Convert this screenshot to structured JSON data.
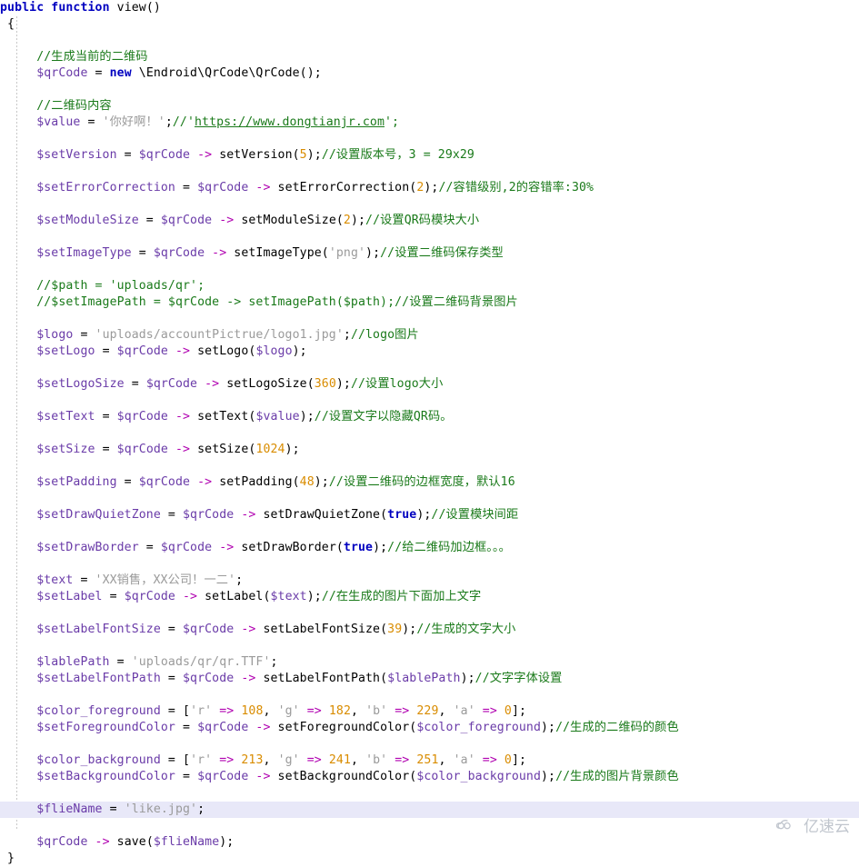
{
  "editor": {
    "language": "php",
    "title": "PHP code editor view",
    "background_color": "#ffffff",
    "highlight_line_color": "#e8e8f8",
    "colors": {
      "keyword": "#0000c0",
      "variable": "#6a3ba8",
      "operator_arrow": "#b000b0",
      "number": "#d98c00",
      "string": "#9a9a9a",
      "comment": "#1a7a1a",
      "commented_code": "#9a9a9a",
      "plain": "#000000"
    }
  },
  "code": {
    "l1_public": "public",
    "l1_function": "function",
    "l1_name": "view",
    "l1_parens": "()",
    "l2_brace": "{",
    "l4_comment": "//生成当前的二维码",
    "l5_var": "$qrCode",
    "l5_eq": " = ",
    "l5_new": "new",
    "l5_class": " \\Endroid\\QrCode\\QrCode",
    "l5_tail": "();",
    "l7_comment": "//二维码内容",
    "l8_var": "$value",
    "l8_eq": " = ",
    "l8_str": "'你好啊！'",
    "l8_semi": ";",
    "l8_cmt_pre": "//'",
    "l8_link": "https://www.dongtianjr.com",
    "l8_cmt_post": "';",
    "l10_var": "$setVersion",
    "l10_eq": " = ",
    "l10_obj": "$qrCode",
    "l10_arrow": " -> ",
    "l10_call": "setVersion",
    "l10_open": "(",
    "l10_num": "5",
    "l10_close": ");",
    "l10_cmt": "//设置版本号，3 = 29x29",
    "l12_var": "$setErrorCorrection",
    "l12_obj": "$qrCode",
    "l12_call": "setErrorCorrection",
    "l12_num": "2",
    "l12_cmt": "//容错级别,2的容错率:30%",
    "l14_var": "$setModuleSize",
    "l14_obj": "$qrCode",
    "l14_call": "setModuleSize",
    "l14_num": "2",
    "l14_cmt": "//设置QR码模块大小",
    "l16_var": "$setImageType",
    "l16_obj": "$qrCode",
    "l16_call": "setImageType",
    "l16_str": "'png'",
    "l16_cmt": "//设置二维码保存类型",
    "l18_cmt": "//$path = 'uploads/qr';",
    "l19_cmt_code": "//$setImagePath = $qrCode -> setImagePath($path);",
    "l19_cmt": "//设置二维码背景图片",
    "l21_var": "$logo",
    "l21_str": "'uploads/accountPictrue/logo1.jpg'",
    "l21_semi": ";",
    "l21_cmt": "//logo图片",
    "l22_var": "$setLogo",
    "l22_obj": "$qrCode",
    "l22_call": "setLogo",
    "l22_arg": "$logo",
    "l24_var": "$setLogoSize",
    "l24_obj": "$qrCode",
    "l24_call": "setLogoSize",
    "l24_num": "360",
    "l24_cmt": "//设置logo大小",
    "l26_var": "$setText",
    "l26_obj": "$qrCode",
    "l26_call": "setText",
    "l26_arg": "$value",
    "l26_cmt": "//设置文字以隐藏QR码。",
    "l28_var": "$setSize",
    "l28_obj": "$qrCode",
    "l28_call": "setSize",
    "l28_num": "1024",
    "l30_var": "$setPadding",
    "l30_obj": "$qrCode",
    "l30_call": "setPadding",
    "l30_num": "48",
    "l30_cmt": "//设置二维码的边框宽度，默认16",
    "l32_var": "$setDrawQuietZone",
    "l32_obj": "$qrCode",
    "l32_call": "setDrawQuietZone",
    "l32_true": "true",
    "l32_cmt": "//设置模块间距",
    "l34_var": "$setDrawBorder",
    "l34_obj": "$qrCode",
    "l34_call": "setDrawBorder",
    "l34_true": "true",
    "l34_cmt": "//给二维码加边框。。。",
    "l36_var": "$text",
    "l36_str": "'XX销售，XX公司！一二'",
    "l37_var": "$setLabel",
    "l37_obj": "$qrCode",
    "l37_call": "setLabel",
    "l37_arg": "$text",
    "l37_cmt": "//在生成的图片下面加上文字",
    "l39_var": "$setLabelFontSize",
    "l39_obj": "$qrCode",
    "l39_call": "setLabelFontSize",
    "l39_num": "39",
    "l39_cmt": "//生成的文字大小",
    "l41_var": "$lablePath",
    "l41_str": "'uploads/qr/qr.TTF'",
    "l42_var": "$setLabelFontPath",
    "l42_obj": "$qrCode",
    "l42_call": "setLabelFontPath",
    "l42_arg": "$lablePath",
    "l42_cmt": "//文字字体设置",
    "l44_var": "$color_foreground",
    "l44_r_key": "'r'",
    "l44_r_val": "108",
    "l44_g_key": "'g'",
    "l44_g_val": "182",
    "l44_b_key": "'b'",
    "l44_b_val": "229",
    "l44_a_key": "'a'",
    "l44_a_val": "0",
    "l45_var": "$setForegroundColor",
    "l45_obj": "$qrCode",
    "l45_call": "setForegroundColor",
    "l45_arg": "$color_foreground",
    "l45_cmt": "//生成的二维码的颜色",
    "l47_var": "$color_background",
    "l47_r_key": "'r'",
    "l47_r_val": "213",
    "l47_g_key": "'g'",
    "l47_g_val": "241",
    "l47_b_key": "'b'",
    "l47_b_val": "251",
    "l47_a_key": "'a'",
    "l47_a_val": "0",
    "l48_var": "$setBackgroundColor",
    "l48_obj": "$qrCode",
    "l48_call": "setBackgroundColor",
    "l48_arg": "$color_background",
    "l48_cmt": "//生成的图片背景颜色",
    "l50_var": "$flieName",
    "l50_str": "'like.jpg'",
    "l52_obj": "$qrCode",
    "l52_call": "save",
    "l52_arg": "$flieName",
    "l53_brace": "}"
  },
  "watermark": {
    "text": "亿速云",
    "icon": "cloud-icon"
  }
}
